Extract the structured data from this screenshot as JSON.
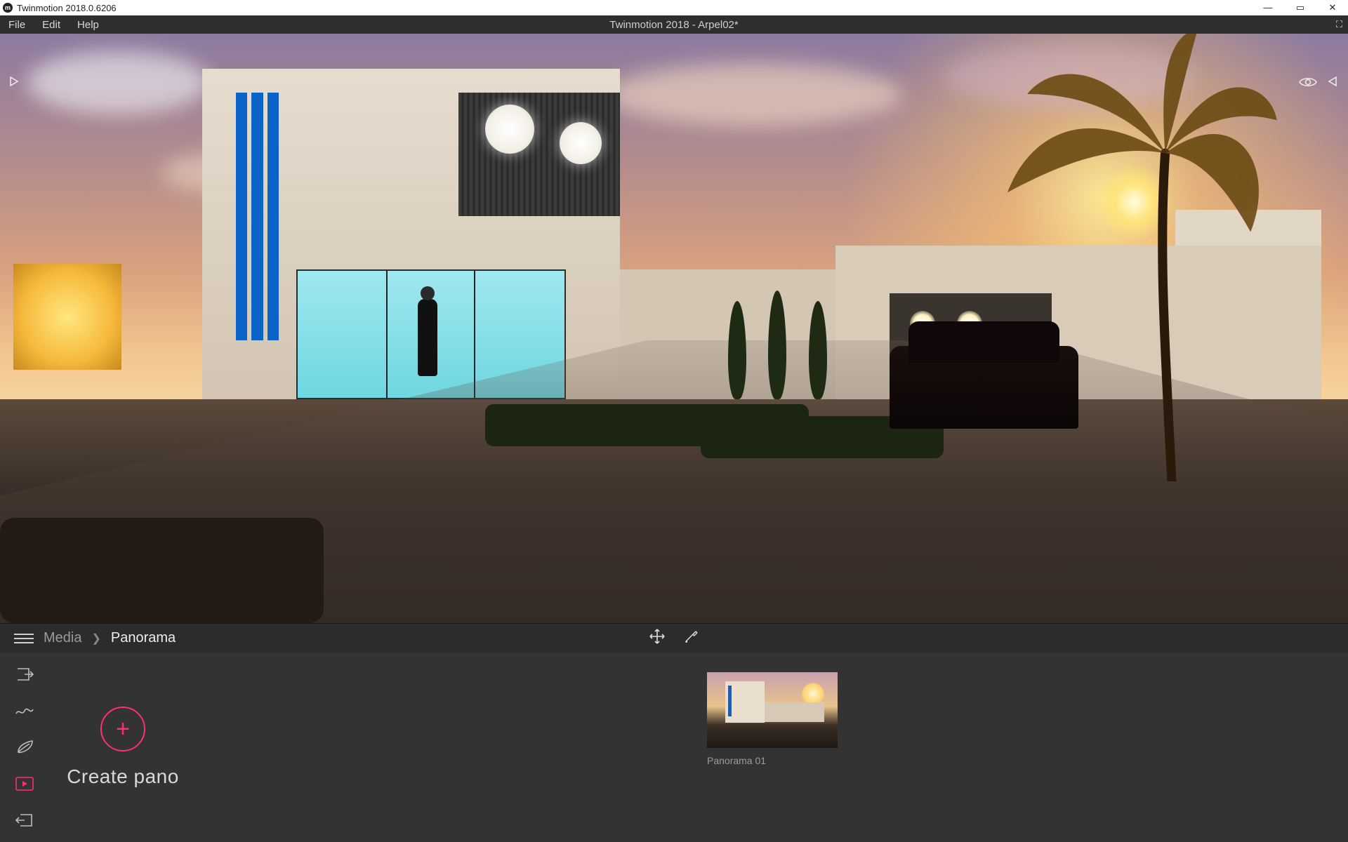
{
  "titlebar": {
    "app_title": "Twinmotion 2018.0.6206"
  },
  "menubar": {
    "items": [
      "File",
      "Edit",
      "Help"
    ],
    "document_title": "Twinmotion 2018 - Arpel02*"
  },
  "viewport": {
    "icons": {
      "play": "play-icon",
      "eye": "eye-icon",
      "triangle": "back-triangle-icon"
    }
  },
  "crumbbar": {
    "root": "Media",
    "current": "Panorama",
    "tools": {
      "move": "move-icon",
      "eyedropper": "eyedropper-icon"
    }
  },
  "dock": {
    "create_label": "Create pano",
    "rail": [
      {
        "name": "import-icon"
      },
      {
        "name": "terrain-icon"
      },
      {
        "name": "leaf-icon"
      },
      {
        "name": "media-icon",
        "active": true
      },
      {
        "name": "export-icon"
      }
    ],
    "items": [
      {
        "label": "Panorama 01"
      }
    ]
  }
}
